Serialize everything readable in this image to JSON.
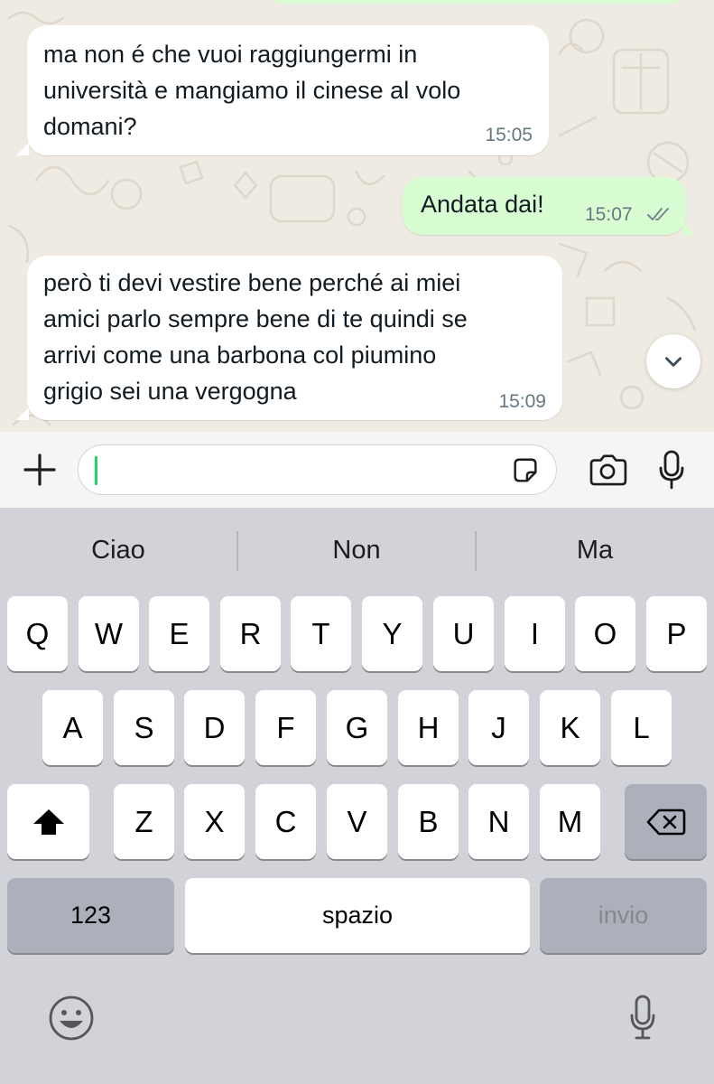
{
  "messages": [
    {
      "direction": "incoming",
      "lines": [
        "ma non é che vuoi raggiungermi in",
        "università e mangiamo il cinese al volo",
        "domani?"
      ],
      "time": "15:05"
    },
    {
      "direction": "outgoing",
      "lines": [
        "Andata dai!"
      ],
      "time": "15:07",
      "status": "read"
    },
    {
      "direction": "incoming",
      "lines": [
        "però ti devi vestire bene perché ai miei",
        "amici parlo sempre bene di te quindi se",
        "arrivi come una barbona col piumino",
        "grigio sei una vergogna"
      ],
      "time": "15:09"
    }
  ],
  "input_bar": {
    "icons": [
      "plus-icon",
      "sticker-icon",
      "camera-icon",
      "microphone-icon"
    ],
    "value": "",
    "accent": "#25d366"
  },
  "keyboard": {
    "suggestions": [
      "Ciao",
      "Non",
      "Ma"
    ],
    "row1": [
      "Q",
      "W",
      "E",
      "R",
      "T",
      "Y",
      "U",
      "I",
      "O",
      "P"
    ],
    "row2": [
      "A",
      "S",
      "D",
      "F",
      "G",
      "H",
      "J",
      "K",
      "L"
    ],
    "row3": [
      "Z",
      "X",
      "C",
      "V",
      "B",
      "N",
      "M"
    ],
    "numbers_label": "123",
    "space_label": "spazio",
    "return_label": "invio",
    "icons": [
      "shift-icon",
      "backspace-icon",
      "emoji-icon",
      "dictation-icon"
    ]
  },
  "colors": {
    "chat_background": "#efeae2",
    "incoming_bubble": "#ffffff",
    "outgoing_bubble": "#d9fdd3",
    "timestamp": "#667781",
    "keyboard_background": "#d1d3d9"
  }
}
